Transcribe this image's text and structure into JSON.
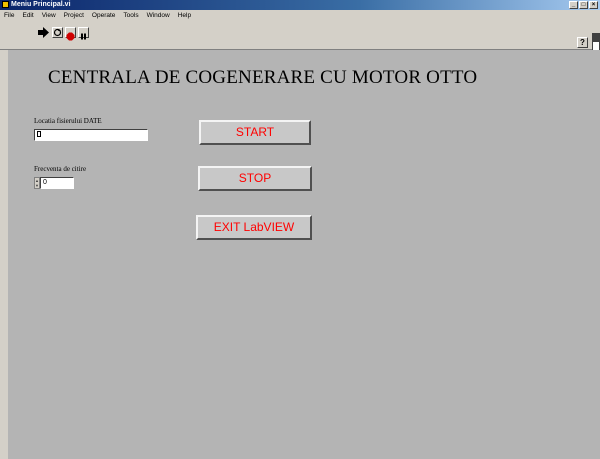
{
  "window": {
    "title": "Meniu Principal.vi",
    "controls": [
      "_",
      "□",
      "×"
    ]
  },
  "menu": {
    "items": [
      {
        "label": "File"
      },
      {
        "label": "Edit"
      },
      {
        "label": "View"
      },
      {
        "label": "Project"
      },
      {
        "label": "Operate"
      },
      {
        "label": "Tools"
      },
      {
        "label": "Window"
      },
      {
        "label": "Help"
      }
    ]
  },
  "toolbar": {
    "help_label": "?"
  },
  "panel": {
    "title": "CENTRALA DE COGENERARE CU MOTOR OTTO",
    "file_path": {
      "label": "Locatia fisierului DATE",
      "value": ""
    },
    "frequency": {
      "label": "Frecventa de citire",
      "value": "0"
    },
    "buttons": {
      "start": "START",
      "stop": "STOP",
      "exit": "EXIT LabVIEW"
    }
  },
  "colors": {
    "panel_bg": "#b4b4b4",
    "button_text": "#ff0000",
    "titlebar": "#0a246a"
  }
}
